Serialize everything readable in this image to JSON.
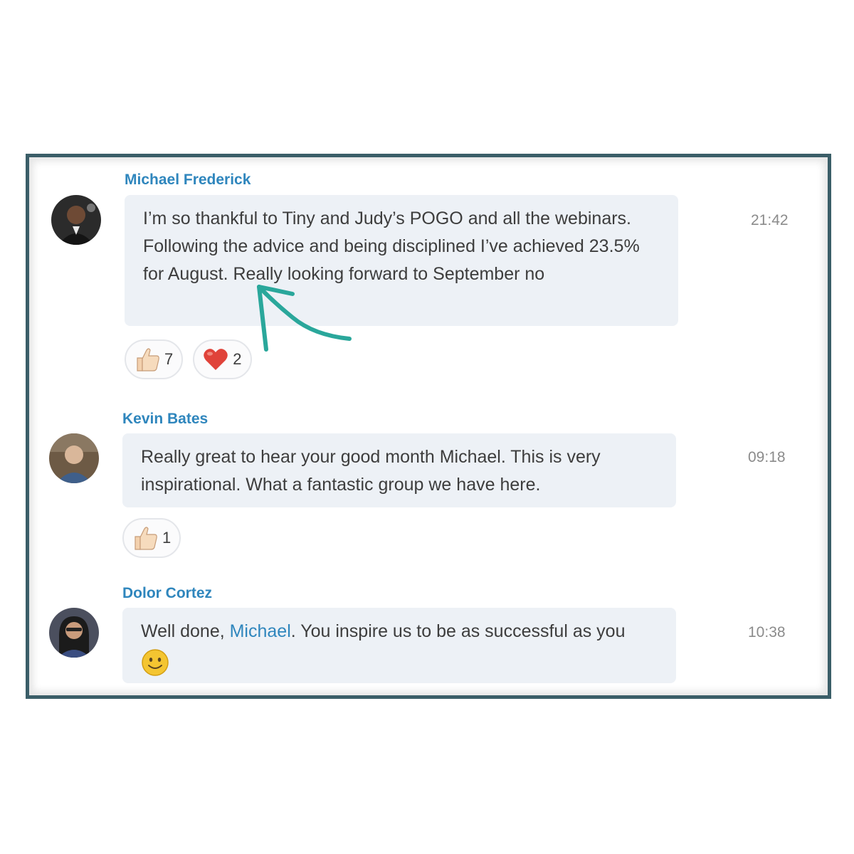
{
  "messages": [
    {
      "author": "Michael Frederick",
      "text": "I’m so thankful to Tiny and Judy’s POGO and all the webinars. Following the advice and being disciplined I’ve achieved 23.5% for August. Really looking forward to September no",
      "time": "21:42",
      "reactions": [
        {
          "icon": "thumbs-up-icon",
          "count": "7"
        },
        {
          "icon": "heart-icon",
          "count": "2"
        }
      ]
    },
    {
      "author": "Kevin Bates",
      "text": "Really great to hear your good month Michael. This is very inspirational. What a fantastic group we have here.",
      "time": "09:18",
      "reactions": [
        {
          "icon": "thumbs-up-icon",
          "count": "1"
        }
      ]
    },
    {
      "author": "Dolor Cortez",
      "text_before": "Well done, ",
      "mention": "Michael",
      "text_after": ". You inspire us to be as successful as you",
      "emoji": "smiley-icon",
      "time": "10:38"
    }
  ],
  "colors": {
    "frame": "#3b5e68",
    "author": "#2f86bd",
    "bubble": "#edf1f6",
    "annotation_arrow": "#2aa79b"
  }
}
